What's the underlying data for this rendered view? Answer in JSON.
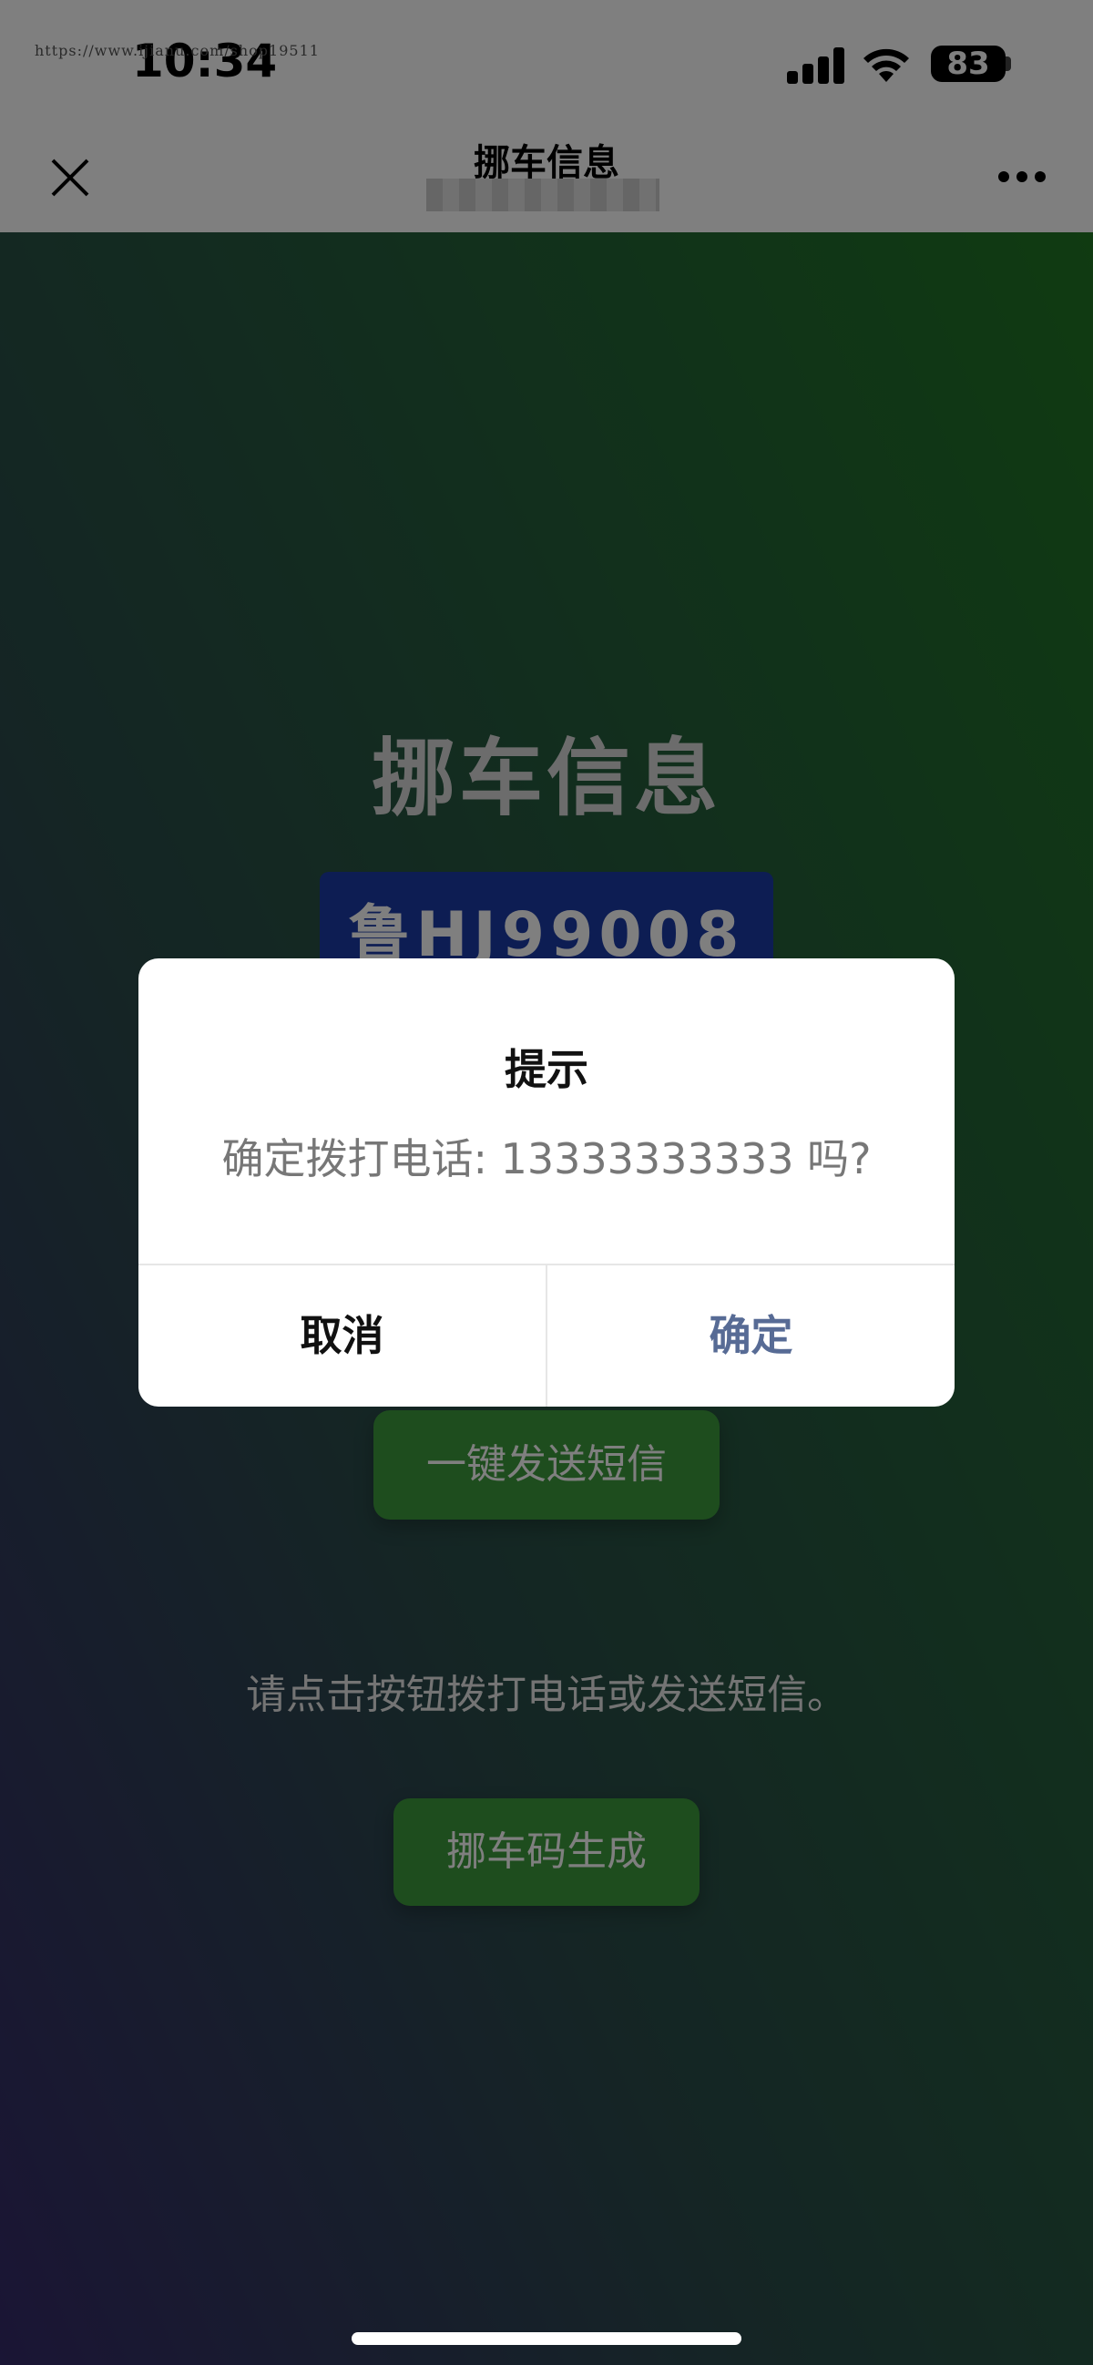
{
  "status_bar": {
    "time": "10:34",
    "url_watermark": "https://www.ijianu.com/shop19511",
    "battery": "83"
  },
  "navbar": {
    "title": "挪车信息"
  },
  "main": {
    "title": "挪车信息",
    "plate": "鲁HJ99008",
    "sms_button": "一键发送短信",
    "hint": "请点击按钮拨打电话或发送短信。",
    "generate_button": "挪车码生成"
  },
  "modal": {
    "title": "提示",
    "message": "确定拨打电话: 13333333333 吗?",
    "cancel_label": "取消",
    "ok_label": "确定"
  },
  "colors": {
    "plate_bg": "#1b3aa6",
    "button_green": "#3d9a3d",
    "ok_text": "#576b95"
  }
}
